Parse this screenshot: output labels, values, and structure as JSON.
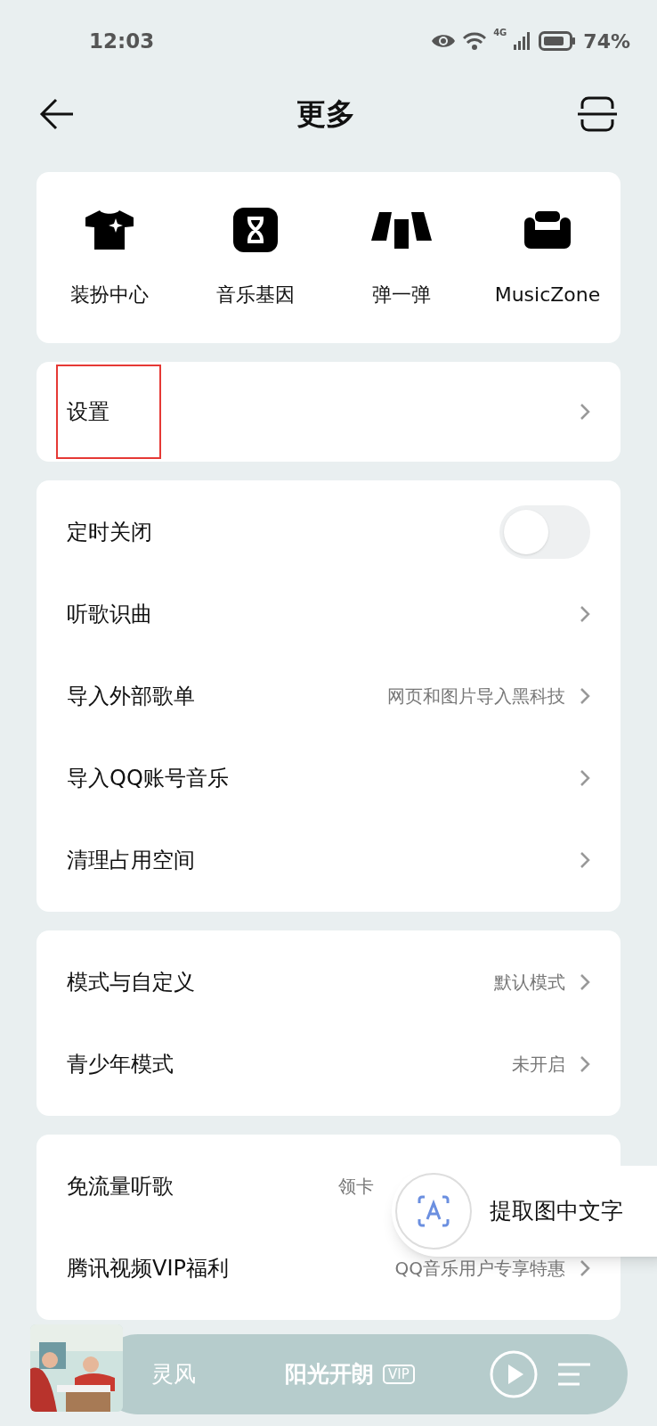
{
  "status_bar": {
    "time": "12:03",
    "battery": "74%",
    "network": "4G"
  },
  "header": {
    "title": "更多"
  },
  "shortcuts": [
    {
      "label": "装扮中心"
    },
    {
      "label": "音乐基因"
    },
    {
      "label": "弹一弹"
    },
    {
      "label": "MusicZone"
    }
  ],
  "sections": [
    {
      "rows": [
        {
          "label": "设置",
          "kind": "link",
          "highlighted": true
        }
      ]
    },
    {
      "rows": [
        {
          "label": "定时关闭",
          "kind": "toggle",
          "on": false
        },
        {
          "label": "听歌识曲",
          "kind": "link"
        },
        {
          "label": "导入外部歌单",
          "kind": "link",
          "value": "网页和图片导入黑科技"
        },
        {
          "label": "导入QQ账号音乐",
          "kind": "link"
        },
        {
          "label": "清理占用空间",
          "kind": "link"
        }
      ]
    },
    {
      "rows": [
        {
          "label": "模式与自定义",
          "kind": "link",
          "value": "默认模式"
        },
        {
          "label": "青少年模式",
          "kind": "link",
          "value": "未开启"
        }
      ]
    },
    {
      "rows": [
        {
          "label": "免流量听歌",
          "kind": "link",
          "value": "领卡"
        },
        {
          "label": "腾讯视频VIP福利",
          "kind": "link",
          "value": "QQ音乐用户专享特惠"
        }
      ]
    }
  ],
  "floating_button": {
    "label": "提取图中文字"
  },
  "player": {
    "artist": "灵风",
    "song": "阳光开朗",
    "badge": "VIP"
  }
}
